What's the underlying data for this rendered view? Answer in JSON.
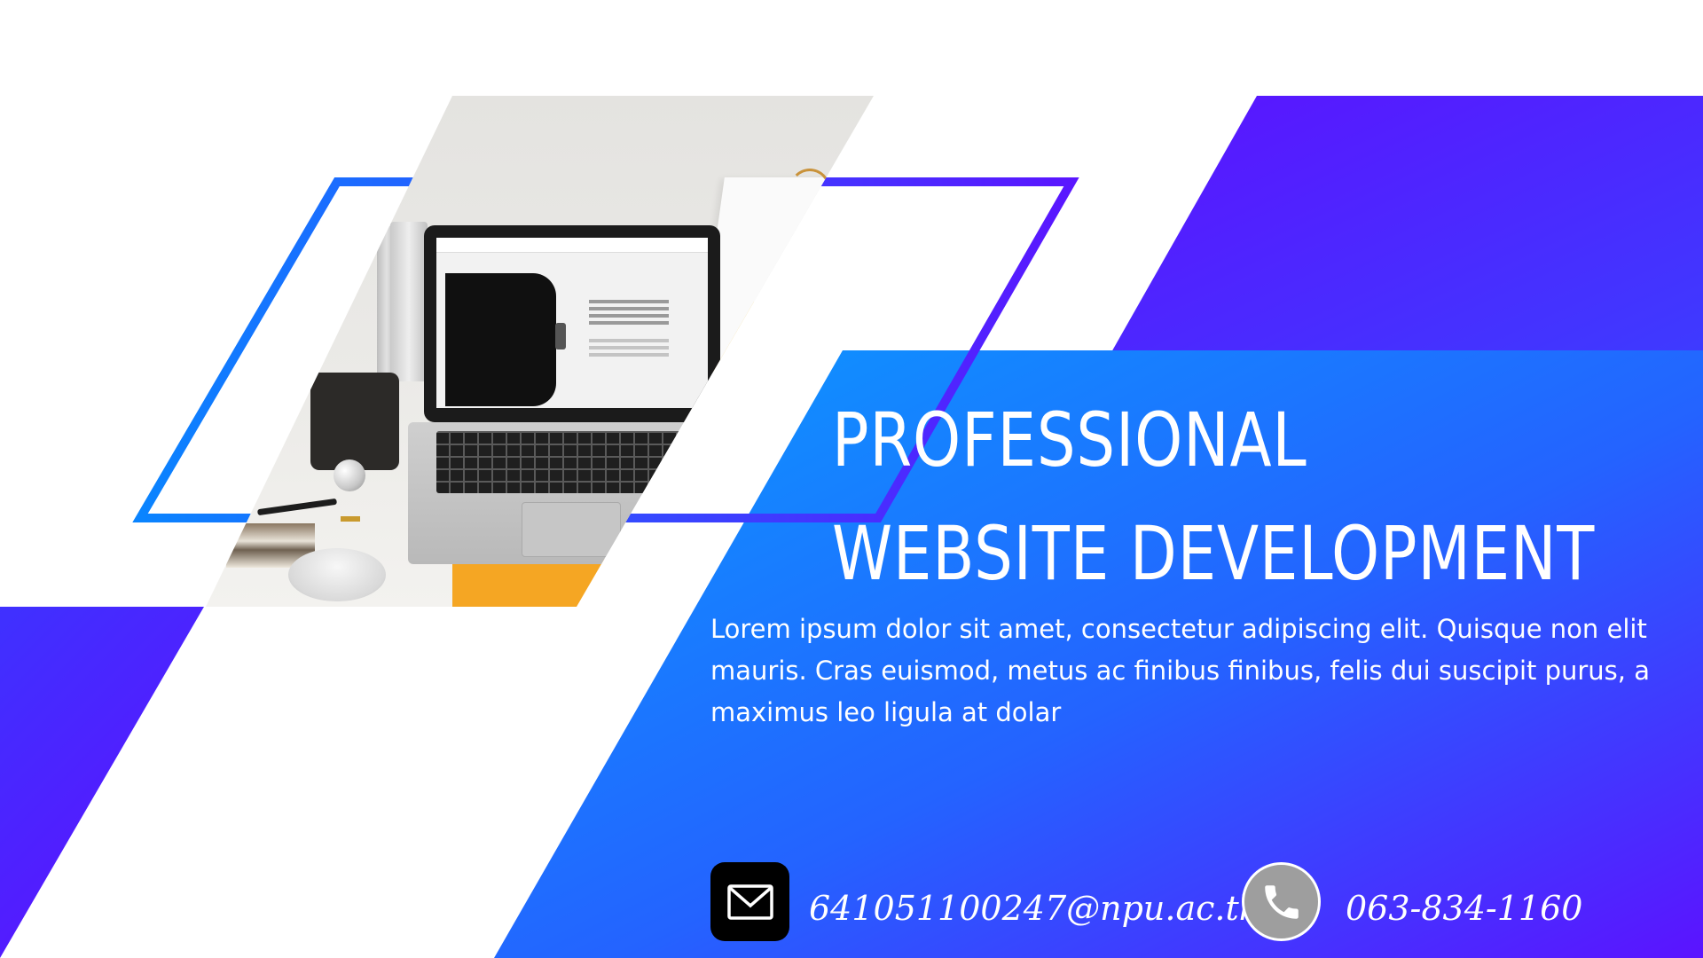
{
  "slide": {
    "headline_line1": "PROFESSIONAL",
    "headline_line2": "WEBSITE DEVELOPMENT",
    "body": "Lorem ipsum dolor sit amet, consectetur adipiscing elit. Quisque non elit mauris. Cras euismod, metus ac finibus finibus, felis dui suscipit purus, a maximus leo ligula at dolar"
  },
  "contact": {
    "email": "641051100247@npu.ac.th",
    "phone": "063-834-1160",
    "email_icon": "mail-icon",
    "phone_icon": "phone-icon"
  },
  "theme": {
    "gradient_blue": "#0a8dff",
    "gradient_violet": "#5b13ff",
    "frame_blue": "#0a84ff",
    "frame_violet": "#5a16ff",
    "text_color": "#ffffff",
    "email_icon_bg": "#000000",
    "phone_icon_bg": "#9e9e9e"
  },
  "photo": {
    "subject": "laptop-on-desk-photo"
  }
}
